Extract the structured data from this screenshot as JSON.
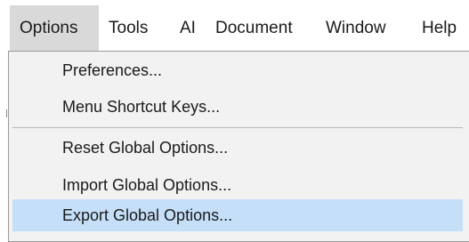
{
  "menubar": {
    "items": [
      {
        "label": "Options"
      },
      {
        "label": "Tools"
      },
      {
        "label": "AI"
      },
      {
        "label": "Document"
      },
      {
        "label": "Window"
      },
      {
        "label": "Help"
      }
    ],
    "active": "Options"
  },
  "options_menu": {
    "groups": [
      {
        "items": [
          {
            "label": "Preferences..."
          },
          {
            "label": "Menu Shortcut Keys..."
          }
        ]
      },
      {
        "items": [
          {
            "label": "Reset Global Options..."
          },
          {
            "label": "Import Global Options..."
          },
          {
            "label": "Export Global Options..."
          }
        ]
      }
    ],
    "highlighted_item": "Export Global Options..."
  },
  "colors": {
    "menubar_active_bg": "#d9d9d9",
    "dropdown_bg": "#f2f2f2",
    "highlight_bg": "#c5dff8",
    "border": "#9a9a9a"
  }
}
